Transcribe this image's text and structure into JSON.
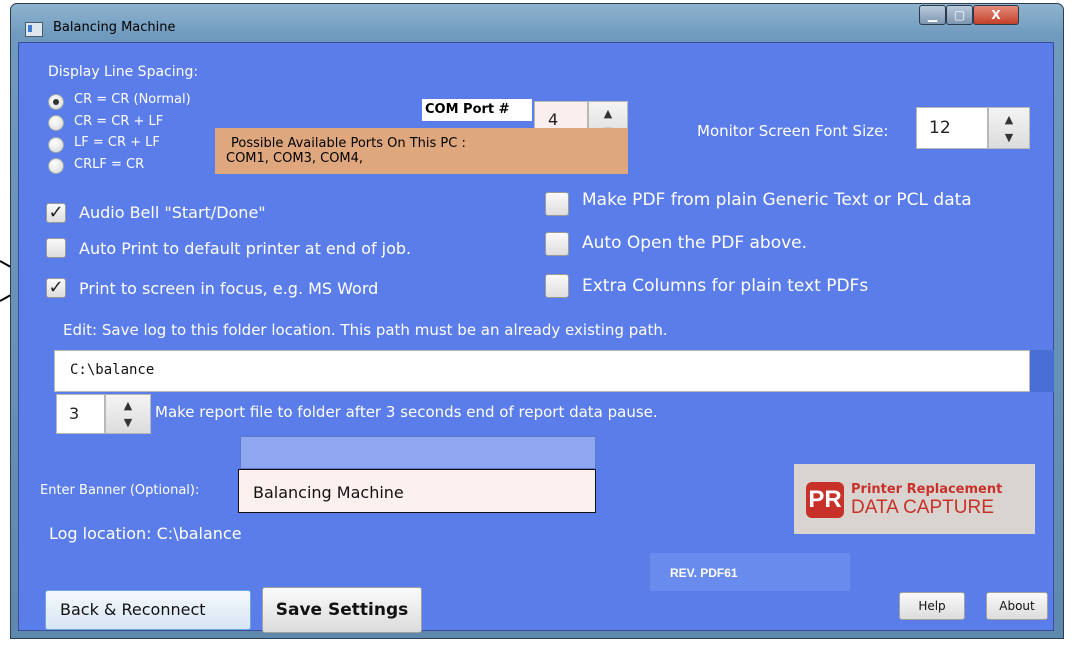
{
  "window": {
    "title": "Balancing Machine"
  },
  "line_spacing": {
    "label": "Display Line Spacing:",
    "options": [
      "CR = CR  (Normal)",
      "CR = CR + LF",
      "LF = CR + LF",
      "CRLF = CR"
    ],
    "selected_index": 0
  },
  "com_port": {
    "label": "COM Port #",
    "value": "4",
    "info_title": "Possible Available Ports On This PC :",
    "info_ports": "COM1, COM3, COM4,"
  },
  "font_size": {
    "label": "Monitor Screen Font Size:",
    "value": "12"
  },
  "options_left": [
    {
      "label": "Audio Bell \"Start/Done\"",
      "checked": true
    },
    {
      "label": "Auto Print to default printer at end of job.",
      "checked": false
    },
    {
      "label": "Print to screen in focus, e.g. MS Word",
      "checked": true
    }
  ],
  "options_right": [
    {
      "label": "Make PDF from plain Generic Text or PCL data",
      "checked": false
    },
    {
      "label": "Auto Open the PDF above.",
      "checked": false
    },
    {
      "label": "Extra Columns for plain text PDFs",
      "checked": false
    }
  ],
  "log_folder": {
    "label": "Edit: Save log to this folder location.  This path must be an already existing path.",
    "value": "C:\\balance"
  },
  "pause": {
    "value": "3",
    "label": "Make report file to folder after 3 seconds end of report data pause."
  },
  "banner": {
    "label": "Enter Banner (Optional):",
    "value": "Balancing Machine"
  },
  "log_location": "Log location: C:\\balance",
  "logo": {
    "initials": "PR",
    "line1": "Printer Replacement",
    "line2": "DATA CAPTURE"
  },
  "revision": "REV. PDF61",
  "buttons": {
    "back": "Back & Reconnect",
    "save": "Save Settings",
    "help": "Help",
    "about": "About"
  },
  "colors": {
    "client_bg": "#5b7de9",
    "com_info_bg": "#dfa77e",
    "logo_red": "#c8312a",
    "logo_bg": "#d9d4d0"
  }
}
